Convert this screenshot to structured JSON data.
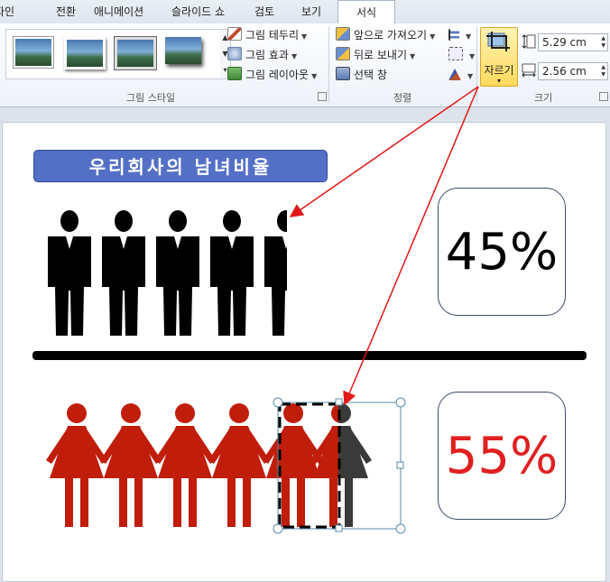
{
  "ribbon_tabs": [
    "자인",
    "전환",
    "애니메이션",
    "슬라이드 쇼",
    "검토",
    "보기",
    "서식"
  ],
  "active_tab": "서식",
  "picture_styles_group": {
    "commands": {
      "border": "그림 테두리",
      "effects": "그림 효과",
      "layout": "그림 레이아웃"
    },
    "label": "그림 스타일"
  },
  "arrange_group": {
    "bring_forward": "앞으로 가져오기",
    "send_backward": "뒤로 보내기",
    "selection_pane": "선택 창",
    "label": "정렬"
  },
  "size_group": {
    "crop_label": "자르기",
    "height": "5.29 cm",
    "width": "2.56 cm",
    "label": "크기"
  },
  "slide": {
    "title": "우리회사의  남녀비율",
    "male_percent": "45%",
    "female_percent": "55%",
    "male_ratio": 0.45,
    "female_ratio": 0.55,
    "male_color": "#000000",
    "female_color": "#c01d0a",
    "female_percent_color": "#e02020",
    "title_color": "#5470c6",
    "arrow_color": "#e01818"
  }
}
